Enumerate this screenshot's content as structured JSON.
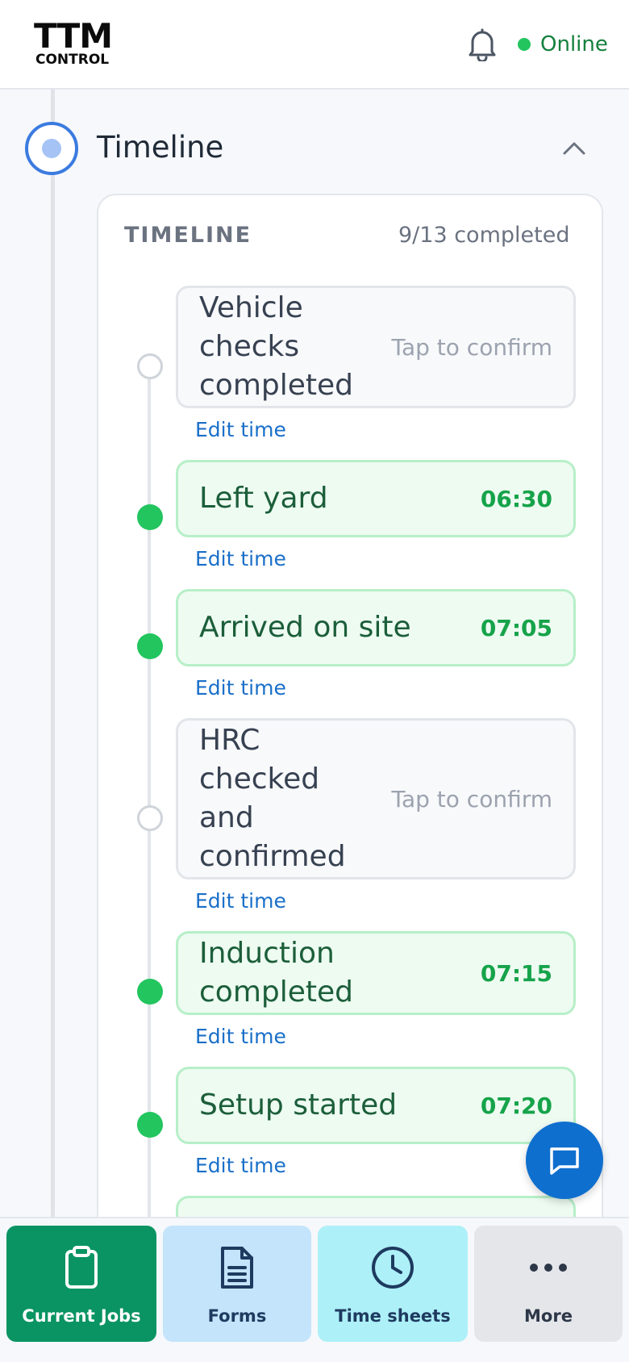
{
  "header": {
    "logo_main": "TTM",
    "logo_sub": "CONTROL",
    "status_text": "Online",
    "status_color": "#22c55e"
  },
  "section": {
    "title": "Timeline"
  },
  "card": {
    "title": "TIMELINE",
    "count": "9/13 completed"
  },
  "steps": [
    {
      "label_lines": [
        "Vehicle",
        "checks",
        "completed"
      ],
      "right": "Tap to confirm",
      "done": false,
      "edit": "Edit time"
    },
    {
      "label_lines": [
        "Left yard"
      ],
      "right": "06:30",
      "done": true,
      "edit": "Edit time"
    },
    {
      "label_lines": [
        "Arrived on site"
      ],
      "right": "07:05",
      "done": true,
      "edit": "Edit time"
    },
    {
      "label_lines": [
        "HRC",
        "checked",
        "and",
        "confirmed"
      ],
      "right": "Tap to confirm",
      "done": false,
      "edit": "Edit time"
    },
    {
      "label_lines": [
        "Induction",
        "completed"
      ],
      "right": "07:15",
      "done": true,
      "edit": "Edit time"
    },
    {
      "label_lines": [
        "Setup started"
      ],
      "right": "07:20",
      "done": true,
      "edit": "Edit time"
    }
  ],
  "nav": {
    "jobs": "Current Jobs",
    "forms": "Forms",
    "time": "Time sheets",
    "more": "More"
  },
  "icons": {
    "bell": "bell-icon",
    "chevron": "chevron-up-icon",
    "chat": "chat-icon",
    "clipboard": "clipboard-icon",
    "document": "document-icon",
    "clock": "clock-icon",
    "more": "more-dots-icon"
  }
}
